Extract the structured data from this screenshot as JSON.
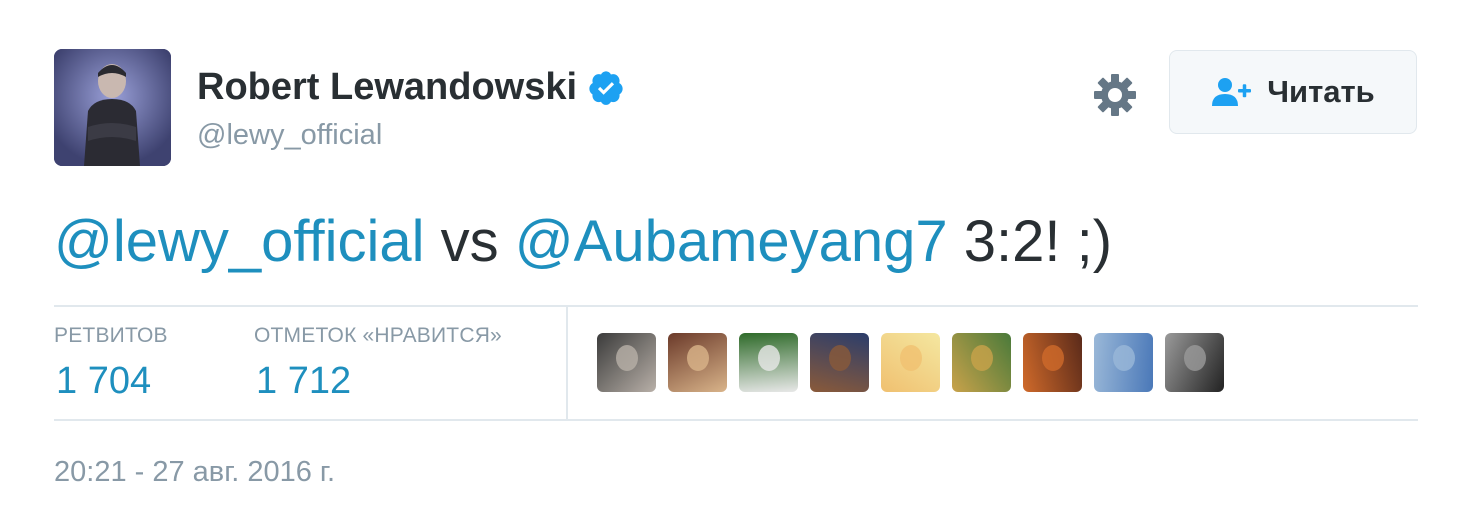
{
  "author": {
    "name": "Robert Lewandowski",
    "handle": "@lewy_official",
    "verified": true
  },
  "actions": {
    "follow_label": "Читать"
  },
  "tweet": {
    "mention1": "@lewy_official",
    "text_mid": " vs ",
    "mention2": "@Aubameyang7",
    "text_end": " 3:2! ;)"
  },
  "stats": {
    "retweets_label": "РЕТВИТОВ",
    "retweets_value": "1 704",
    "likes_label": "ОТМЕТОК «НРАВИТСЯ»",
    "likes_value": "1 712"
  },
  "likers": [
    {
      "colors": [
        "#3b3b3b",
        "#b8b0a8"
      ]
    },
    {
      "colors": [
        "#6b3a2a",
        "#d9b48a"
      ]
    },
    {
      "colors": [
        "#2f6b2a",
        "#e8e8e8"
      ]
    },
    {
      "colors": [
        "#2b3d6b",
        "#8a5a3a"
      ]
    },
    {
      "colors": [
        "#f4e7a0",
        "#f0c070"
      ]
    },
    {
      "colors": [
        "#4a7a3a",
        "#c9a24a"
      ]
    },
    {
      "colors": [
        "#5a2a1a",
        "#d06a2a"
      ]
    },
    {
      "colors": [
        "#4a78b8",
        "#9ab8d8"
      ]
    },
    {
      "colors": [
        "#222222",
        "#9a9a9a"
      ]
    }
  ],
  "timestamp": "20:21 - 27 авг. 2016 г.",
  "colors": {
    "link": "#1e8fbe",
    "muted": "#8899a6",
    "verified": "#1da1f2"
  }
}
